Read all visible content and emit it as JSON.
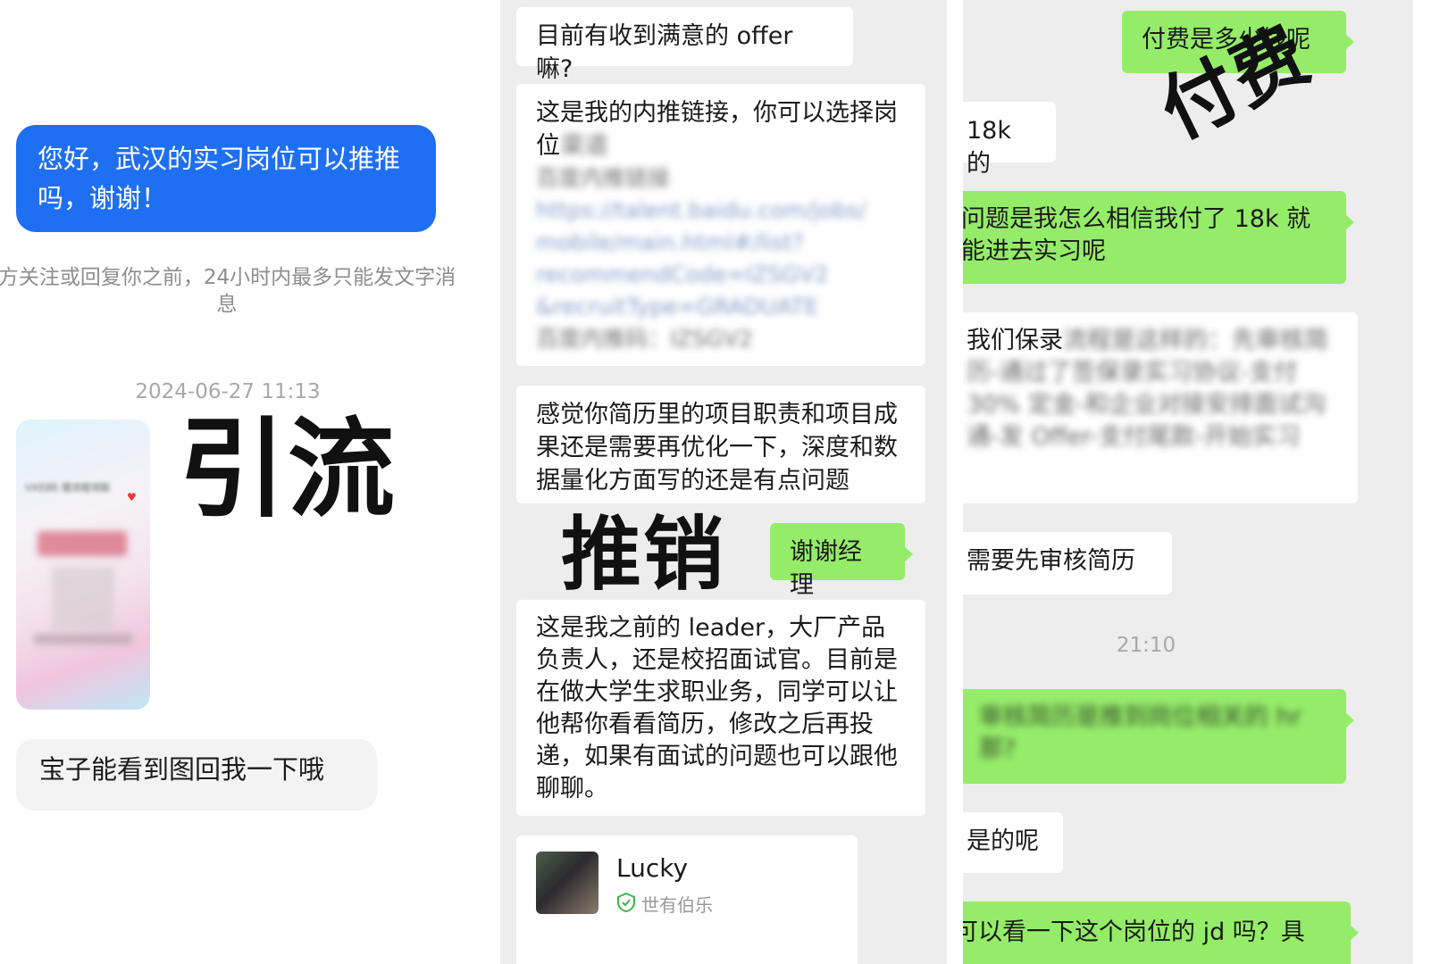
{
  "left": {
    "blue_message": "您好，武汉的实习岗位可以推推吗，谢谢！",
    "notice": "方关注或回复你之前，24小时内最多只能发文字消息",
    "timestamp": "2024-06-27 11:13",
    "poster_caption": "VX扫码 理流程领取",
    "reply": "宝子能看到图回我一下哦",
    "overlay_label": "引流"
  },
  "middle": {
    "msg1": "目前有收到满意的 offer 嘛?",
    "msg2_line1": "这是我的内推链接，你可以选择岗",
    "msg2_line2": "位",
    "msg2_blurred": [
      "百度内推链接",
      "https://talent.baidu.com/jobs/",
      "mobile/main.html#/list?",
      "recommendCode=IZSGV2",
      "&recruitType=GRADUATE",
      "百度内推码：IZSGV2"
    ],
    "msg3": "感觉你简历里的项目职责和项目成果还是需要再优化一下，深度和数据量化方面写的还是有点问题",
    "thanks": "谢谢经理",
    "msg4": "这是我之前的 leader，大厂产品负责人，还是校招面试官。目前是在做大学生求职业务，同学可以让他帮你看看简历，修改之后再投递，如果有面试的问题也可以跟他聊聊。",
    "contact_name": "Lucky",
    "contact_sub": "世有伯乐",
    "overlay_label": "推销"
  },
  "right": {
    "msg1": "付费是多少钱呢",
    "msg2": "18k 的",
    "msg3": "问题是我怎么相信我付了 18k 就能进去实习呢",
    "msg4_visible": "我们保录",
    "msg4_blurred": "流程是这样的：先审核简历-通过了签保录实习协议-支付 30% 定金-和企业对接安排面试沟通-发 Offer-支付尾款-开始实习",
    "msg5": "需要先审核简历",
    "time": "21:10",
    "msg6_blurred": "审核简历是推到岗位相关的 hr 那?",
    "msg7": "是的呢",
    "msg8": "可以看一下这个岗位的 jd 吗？具",
    "overlay_label": "付费"
  },
  "colors": {
    "blue_bubble": "#1f6ff2",
    "green_bubble": "#95ec69",
    "chat_bg": "#ededed"
  }
}
